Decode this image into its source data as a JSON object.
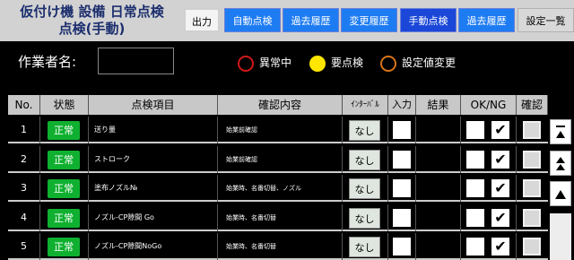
{
  "header": {
    "title_line1": "仮付け機 設備 日常点検",
    "title_line2": "点検(手動)",
    "buttons": {
      "output": "出力",
      "auto_check": "自動点検",
      "history_past_1": "過去履歴",
      "change_history": "変更履歴",
      "manual_check": "手動点検",
      "history_past_2": "過去履歴",
      "settings_list": "設定一覧"
    }
  },
  "operator": {
    "label": "作業者名:",
    "value": ""
  },
  "legend": {
    "abnormal": "異常中",
    "required": "要点検",
    "changed": "設定値変更",
    "colors": {
      "abnormal": "#d01818",
      "required": "#ffe600",
      "changed": "#d8741a"
    }
  },
  "table": {
    "headers": [
      "No.",
      "状態",
      "点検項目",
      "確認内容",
      "ｲﾝﾀｰﾊﾞﾙ",
      "入力",
      "結果",
      "OK/NG",
      "確認"
    ],
    "rows": [
      {
        "no": "1",
        "status": "正常",
        "item": "送り量",
        "confirm": "始業前確認",
        "interval": "なし",
        "ok_checked": true
      },
      {
        "no": "2",
        "status": "正常",
        "item": "ストローク",
        "confirm": "始業前確認",
        "interval": "なし",
        "ok_checked": true
      },
      {
        "no": "3",
        "status": "正常",
        "item": "塗布ノズル№",
        "confirm": "始業時、名番切替、ノズル",
        "interval": "なし",
        "ok_checked": true
      },
      {
        "no": "4",
        "status": "正常",
        "item": "ノズル-CP隙間 Go",
        "confirm": "始業時、名番切替",
        "interval": "なし",
        "ok_checked": true
      },
      {
        "no": "5",
        "status": "正常",
        "item": "ノズル-CP隙間NoGo",
        "confirm": "始業時、名番切替",
        "interval": "なし",
        "ok_checked": true
      }
    ],
    "check_mark": "✔",
    "status_color": "#0fb030"
  },
  "scroll": {
    "icons": [
      "scroll-top-icon",
      "page-up-icon",
      "line-up-icon"
    ]
  }
}
